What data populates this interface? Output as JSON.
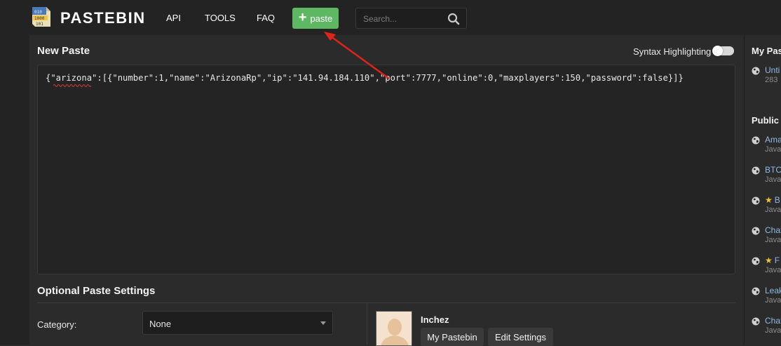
{
  "header": {
    "logo_text": "PASTEBIN",
    "nav": [
      "API",
      "TOOLS",
      "FAQ"
    ],
    "paste_button": "paste",
    "search_placeholder": "Search..."
  },
  "new_paste": {
    "title": "New Paste",
    "syntax_label": "Syntax Highlighting",
    "syntax_enabled": false,
    "content": "{\"arizona\":[{\"number\":1,\"name\":\"ArizonaRp\",\"ip\":\"141.94.184.110\",\"port\":7777,\"online\":0,\"maxplayers\":150,\"password\":false}]}"
  },
  "optional": {
    "title": "Optional Paste Settings",
    "category_label": "Category:",
    "category_value": "None"
  },
  "user": {
    "name": "Inchez",
    "my_pastebin": "My Pastebin",
    "edit_settings": "Edit Settings"
  },
  "sidebar": {
    "my_pastes_title": "My Pas",
    "my_pastes": [
      {
        "title": "Unti",
        "sub": "283"
      }
    ],
    "public_title": "Public",
    "public_pastes": [
      {
        "title": "Ama",
        "sub": "Java",
        "starred": false
      },
      {
        "title": "BTC",
        "sub": "Java",
        "starred": false
      },
      {
        "title": "B",
        "sub": "Java",
        "starred": true
      },
      {
        "title": "Chat",
        "sub": "Java",
        "starred": false
      },
      {
        "title": "F",
        "sub": "Java",
        "starred": true
      },
      {
        "title": "Leak",
        "sub": "Java",
        "starred": false
      },
      {
        "title": "Chat",
        "sub": "Java",
        "starred": false
      }
    ]
  },
  "colors": {
    "accent_green": "#5eb863",
    "link_blue": "#8fb9e4",
    "annotation_red": "#e0241b",
    "star_yellow": "#f1c232"
  }
}
